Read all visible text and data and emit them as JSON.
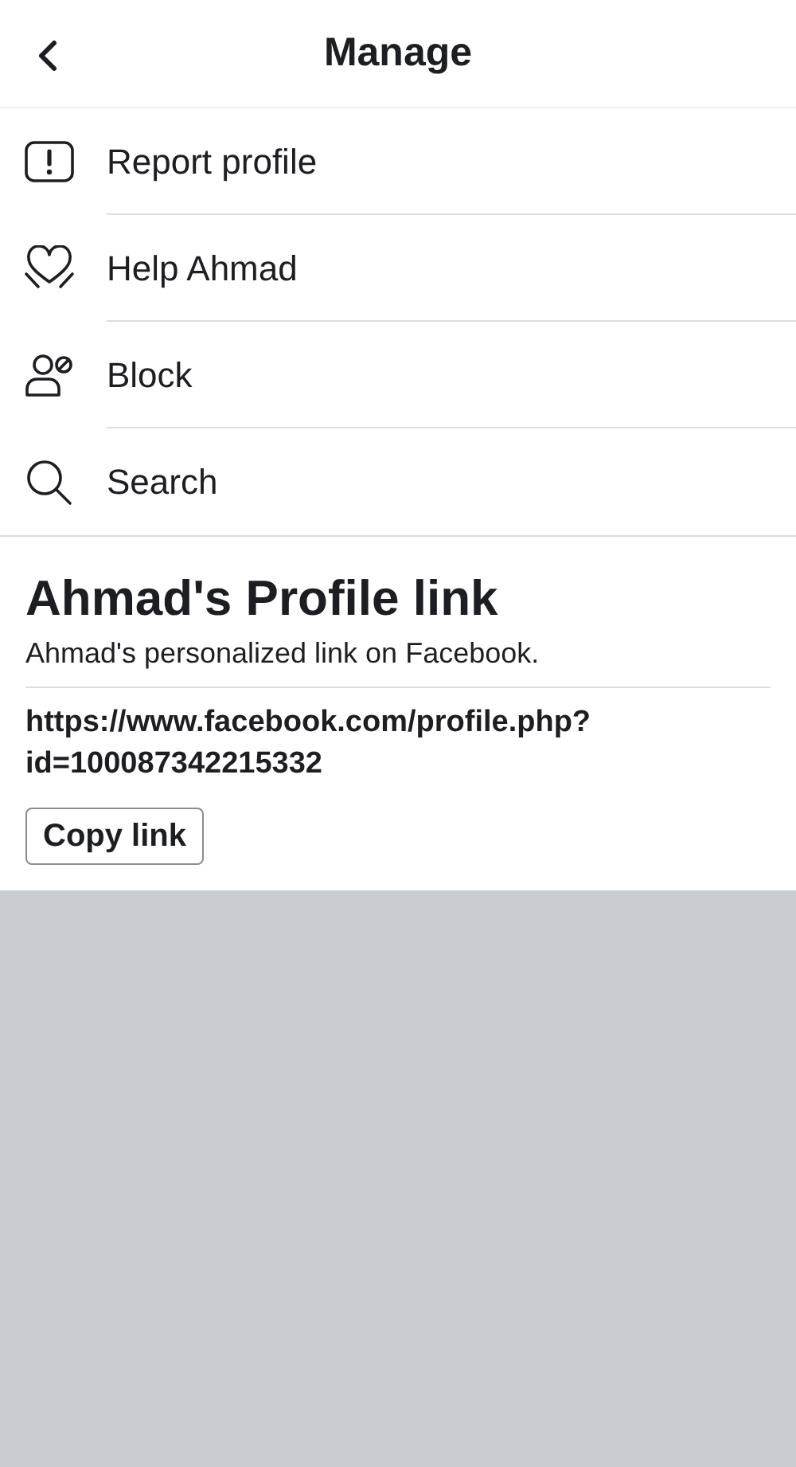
{
  "header": {
    "title": "Manage"
  },
  "menu_items": [
    {
      "kind": "report",
      "label": "Report profile"
    },
    {
      "kind": "help",
      "label": "Help Ahmad"
    },
    {
      "kind": "block",
      "label": "Block"
    },
    {
      "kind": "search",
      "label": "Search"
    }
  ],
  "profile_link": {
    "title": "Ahmad's Profile link",
    "subtitle": "Ahmad's personalized link on Facebook.",
    "url": "https://www.facebook.com/profile.php?\nid=100087342215332",
    "button": "Copy link"
  }
}
